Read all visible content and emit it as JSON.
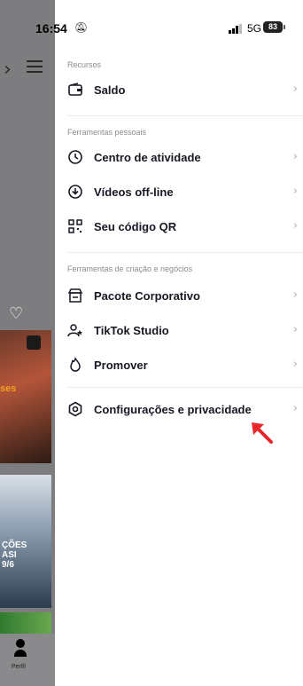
{
  "status_bar": {
    "time": "16:54",
    "network": "5G",
    "battery": "83"
  },
  "background": {
    "thumb1_text": "ses",
    "thumb2_text": "ÇÕES\nASI\n9/6",
    "tab_profile_label": "Perfil"
  },
  "menu": {
    "sections": [
      {
        "title": "Recursos",
        "items": [
          {
            "label": "Saldo",
            "icon": "wallet-icon"
          }
        ]
      },
      {
        "title": "Ferramentas pessoais",
        "items": [
          {
            "label": "Centro de atividade",
            "icon": "clock-icon"
          },
          {
            "label": "Vídeos off-line",
            "icon": "download-icon"
          },
          {
            "label": "Seu código QR",
            "icon": "qr-code-icon"
          }
        ]
      },
      {
        "title": "Ferramentas de criação e negócios",
        "items": [
          {
            "label": "Pacote Corporativo",
            "icon": "storefront-icon"
          },
          {
            "label": "TikTok Studio",
            "icon": "person-star-icon"
          },
          {
            "label": "Promover",
            "icon": "flame-icon"
          }
        ]
      }
    ],
    "settings_label": "Configurações e privacidade",
    "chevron": "›"
  },
  "annotation": {
    "arrow_color": "#e8262b"
  }
}
